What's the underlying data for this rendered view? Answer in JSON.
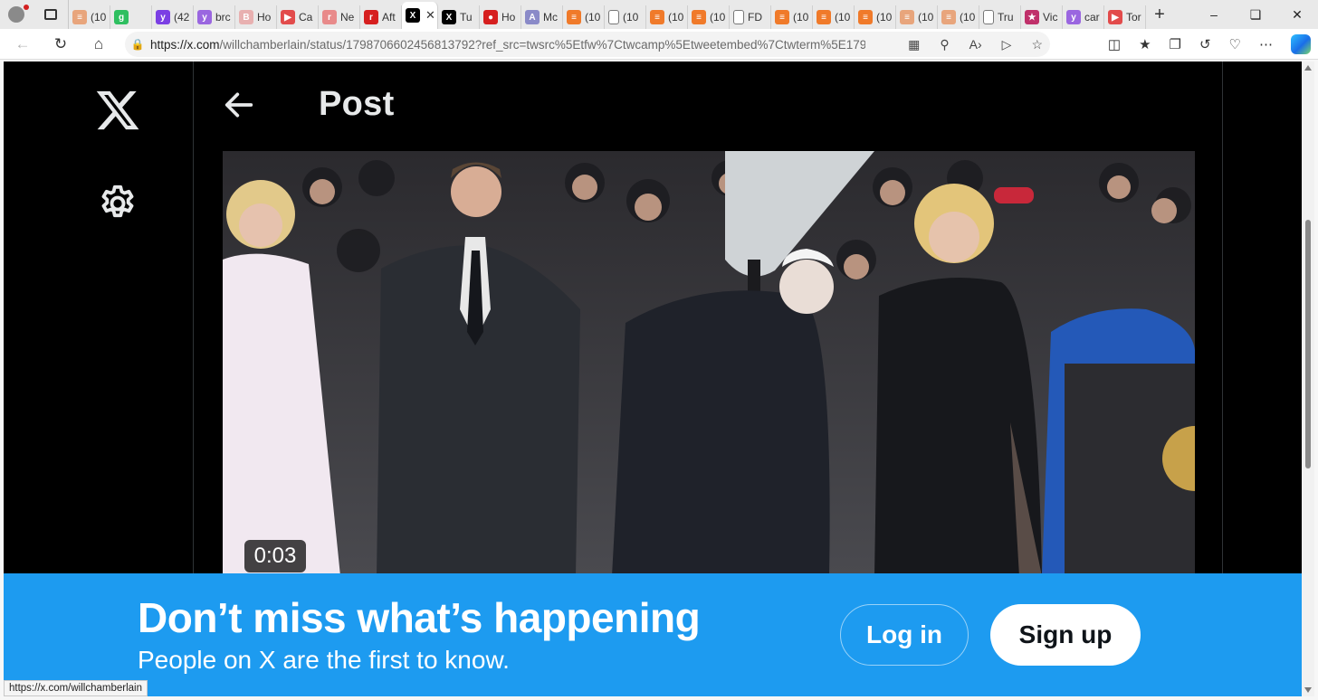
{
  "browser": {
    "tabs": [
      {
        "label": "(10",
        "icon": "substack-icon",
        "color": "#e8a57c"
      },
      {
        "label": "",
        "icon": "g-icon",
        "color": "#2fbf60"
      },
      {
        "label": "(42",
        "icon": "yahoo-icon",
        "color": "#7b3fe4"
      },
      {
        "label": "brc",
        "icon": "yahoo-icon",
        "color": "#9a66e0"
      },
      {
        "label": "Ho",
        "icon": "bi-icon",
        "color": "#e8b0b0"
      },
      {
        "label": "Ca",
        "icon": "youtube-icon",
        "color": "#e24b4b"
      },
      {
        "label": "Ne",
        "icon": "r-icon",
        "color": "#e88a8a"
      },
      {
        "label": "Aft",
        "icon": "r-icon",
        "color": "#d61f1f"
      },
      {
        "label": "",
        "icon": "x-icon",
        "color": "#000000",
        "active": true
      },
      {
        "label": "Tu",
        "icon": "x-icon",
        "color": "#000000"
      },
      {
        "label": "Ho",
        "icon": "pin-icon",
        "color": "#d61f1f"
      },
      {
        "label": "Mc",
        "icon": "a-icon",
        "color": "#8a8ac8"
      },
      {
        "label": "(10",
        "icon": "substack-icon",
        "color": "#f07a2a"
      },
      {
        "label": "(10",
        "icon": "page-icon",
        "color": "#ffffff"
      },
      {
        "label": "(10",
        "icon": "substack-icon",
        "color": "#f07a2a"
      },
      {
        "label": "(10",
        "icon": "substack-icon",
        "color": "#f07a2a"
      },
      {
        "label": "FD",
        "icon": "page-icon",
        "color": "#ffffff"
      },
      {
        "label": "(10",
        "icon": "substack-icon",
        "color": "#f07a2a"
      },
      {
        "label": "(10",
        "icon": "substack-icon",
        "color": "#f07a2a"
      },
      {
        "label": "(10",
        "icon": "substack-icon",
        "color": "#f07a2a"
      },
      {
        "label": "(10",
        "icon": "substack-icon",
        "color": "#e8a57c"
      },
      {
        "label": "(10",
        "icon": "substack-icon",
        "color": "#e8a57c"
      },
      {
        "label": "Tru",
        "icon": "page-icon",
        "color": "#ffffff"
      },
      {
        "label": "Vic",
        "icon": "star-icon",
        "color": "#c0306a"
      },
      {
        "label": "car",
        "icon": "yahoo-icon",
        "color": "#9a66e0"
      },
      {
        "label": "Tor",
        "icon": "youtube-icon",
        "color": "#e24b4b"
      }
    ],
    "url_host": "https://x.com",
    "url_rest": "/willchamberlain/status/1798706602456813792?ref_src=twsrc%5Etfw%7Ctwcamp%5Etweetembed%7Ctwterm%5E1798...",
    "status_url": "https://x.com/willchamberlain"
  },
  "page": {
    "title": "Post",
    "video_duration": "0:03"
  },
  "banner": {
    "title": "Don’t miss what’s happening",
    "subtitle": "People on X are the first to know.",
    "login_label": "Log in",
    "signup_label": "Sign up",
    "color": "#1d9bf0"
  }
}
